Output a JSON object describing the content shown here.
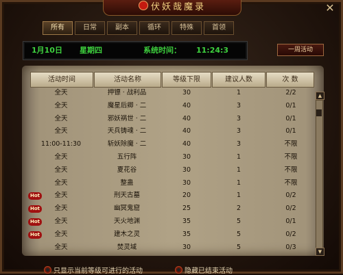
{
  "window": {
    "title": "伏妖哉魔录"
  },
  "tabs": [
    "所有",
    "日常",
    "副本",
    "循环",
    "特殊",
    "首领"
  ],
  "status": {
    "date": "1月10日",
    "weekday": "星期四",
    "time_label": "系统时间：",
    "time": "11:24:3"
  },
  "week_button": "一周活动",
  "columns": [
    "活动时间",
    "活动名称",
    "等级下限",
    "建议人数",
    "次 数"
  ],
  "rows": [
    {
      "time": "全天",
      "name": "押镖 · 战利品",
      "level": "30",
      "people": "1",
      "count": "2/2",
      "hot": false
    },
    {
      "time": "全天",
      "name": "魔星后卿 · 二",
      "level": "40",
      "people": "3",
      "count": "0/1",
      "hot": false
    },
    {
      "time": "全天",
      "name": "邪妖祸世 · 二",
      "level": "40",
      "people": "3",
      "count": "0/1",
      "hot": false
    },
    {
      "time": "全天",
      "name": "天兵铸魂 · 二",
      "level": "40",
      "people": "3",
      "count": "0/1",
      "hot": false
    },
    {
      "time": "11:00-11:30",
      "name": "斩妖除魔 · 二",
      "level": "40",
      "people": "3",
      "count": "不限",
      "hot": false
    },
    {
      "time": "全天",
      "name": "五行阵",
      "level": "30",
      "people": "1",
      "count": "不限",
      "hot": false
    },
    {
      "time": "全天",
      "name": "夏花谷",
      "level": "30",
      "people": "1",
      "count": "不限",
      "hot": false
    },
    {
      "time": "全天",
      "name": "整蛊",
      "level": "30",
      "people": "1",
      "count": "不限",
      "hot": false
    },
    {
      "time": "全天",
      "name": "刑天古墓",
      "level": "20",
      "people": "1",
      "count": "0/2",
      "hot": true
    },
    {
      "time": "全天",
      "name": "幽冥鬼窟",
      "level": "25",
      "people": "2",
      "count": "0/2",
      "hot": true
    },
    {
      "time": "全天",
      "name": "天火地渊",
      "level": "35",
      "people": "5",
      "count": "0/1",
      "hot": true
    },
    {
      "time": "全天",
      "name": "建木之灵",
      "level": "35",
      "people": "5",
      "count": "0/2",
      "hot": true
    },
    {
      "time": "全天",
      "name": "焚灵域",
      "level": "30",
      "people": "5",
      "count": "0/3",
      "hot": false
    }
  ],
  "hot_label": "Hot",
  "footer": {
    "option_1": "只显示当前等级可进行的活动",
    "option_2": "隐藏已结束活动"
  },
  "colors": {
    "status_text": "#3ed13e",
    "hot_badge": "#a01010"
  }
}
